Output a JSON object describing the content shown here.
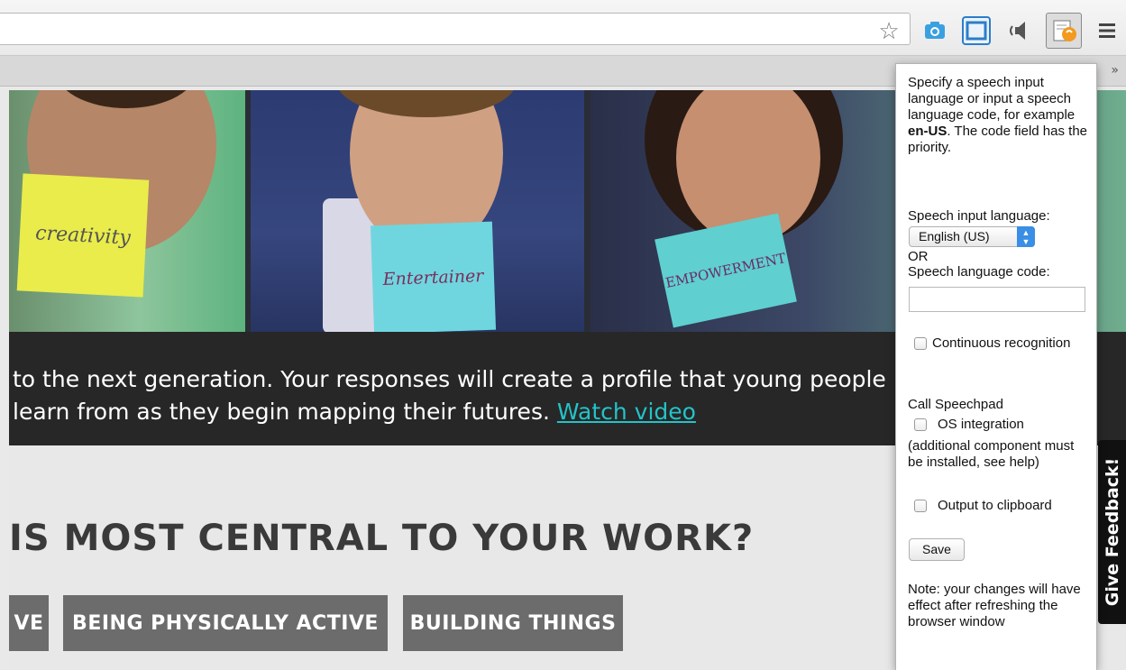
{
  "browser": {
    "toolbar_icons": [
      "star-icon",
      "camera-icon",
      "screen-capture-icon",
      "speaker-icon",
      "speechpad-extension-icon",
      "menu-icon"
    ],
    "bookmarks_overflow": "»"
  },
  "page": {
    "photo_notes": [
      "creativity",
      "Entertainer",
      "EMPOWERMENT"
    ],
    "quote_line1": "to the next generation. Your responses will create a profile that young people",
    "quote_line2": "learn from as they begin mapping their futures.",
    "watch_video": "Watch video",
    "question": "IS MOST CENTRAL TO YOUR WORK?",
    "chips": [
      "VE",
      "BEING PHYSICALLY ACTIVE",
      "BUILDING THINGS"
    ],
    "feedback": "Give Feedback!"
  },
  "popup": {
    "intro_1": "Specify a speech input language or input a speech language code, for example ",
    "intro_code": "en-US",
    "intro_2": ". The code field has the priority.",
    "lang_label": "Speech input language:",
    "lang_value": "English (US)",
    "or": "OR",
    "code_label": "Speech language code:",
    "code_value": "",
    "continuous": "Continuous recognition",
    "call_label": "Call Speechpad",
    "os_integration": "OS integration",
    "os_note": "(additional component must be installed, see help)",
    "clipboard": "Output to clipboard",
    "save": "Save",
    "note": "Note: your changes will have effect after refreshing the browser window"
  }
}
